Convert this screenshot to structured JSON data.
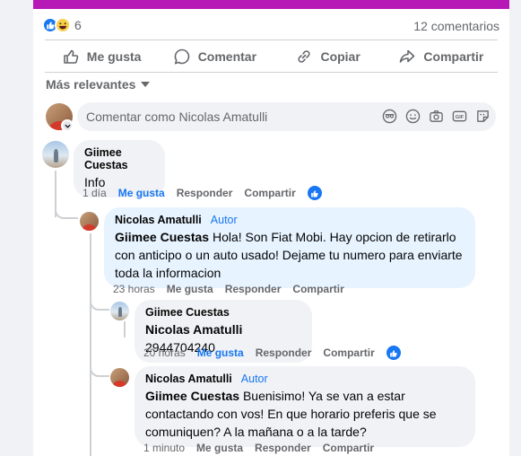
{
  "post": {
    "reaction_count": "6",
    "comments_count": "12 comentarios"
  },
  "actions": {
    "like": "Me gusta",
    "comment": "Comentar",
    "copy": "Copiar",
    "share": "Compartir"
  },
  "sort": {
    "label": "Más relevantes"
  },
  "composer": {
    "placeholder": "Comentar como Nicolas Amatulli"
  },
  "comments": [
    {
      "author": "Giimee Cuestas",
      "badge": "",
      "tag": "",
      "text": "Info",
      "time": "1 día",
      "like": "Me gusta",
      "reply": "Responder",
      "share": "Compartir"
    },
    {
      "author": "Nicolas Amatulli",
      "badge": "Autor",
      "tag": "Giimee Cuestas",
      "text": " Hola! Son Fiat Mobi. Hay opcion de retirarlo con anticipo o un auto usado! Dejame tu numero para enviarte toda la informacion",
      "time": "23 horas",
      "like": "Me gusta",
      "reply": "Responder",
      "share": "Compartir"
    },
    {
      "author": "Giimee Cuestas",
      "badge": "",
      "tag": "Nicolas Amatulli",
      "text": " 2944704240",
      "time": "20 horas",
      "like": "Me gusta",
      "reply": "Responder",
      "share": "Compartir"
    },
    {
      "author": "Nicolas Amatulli",
      "badge": "Autor",
      "tag": "Giimee Cuestas",
      "text": " Buenisimo! Ya se van a estar contactando con vos! En que horario preferis que se comuniquen? A la mañana o a la tarde?",
      "time": "1 minuto",
      "like": "Me gusta",
      "reply": "Responder",
      "share": "Compartir"
    }
  ],
  "colors": {
    "accent": "#1877f2",
    "top_bar": "#b619b6",
    "author_bubble": "#e7f3ff",
    "bubble": "#f0f2f5"
  }
}
